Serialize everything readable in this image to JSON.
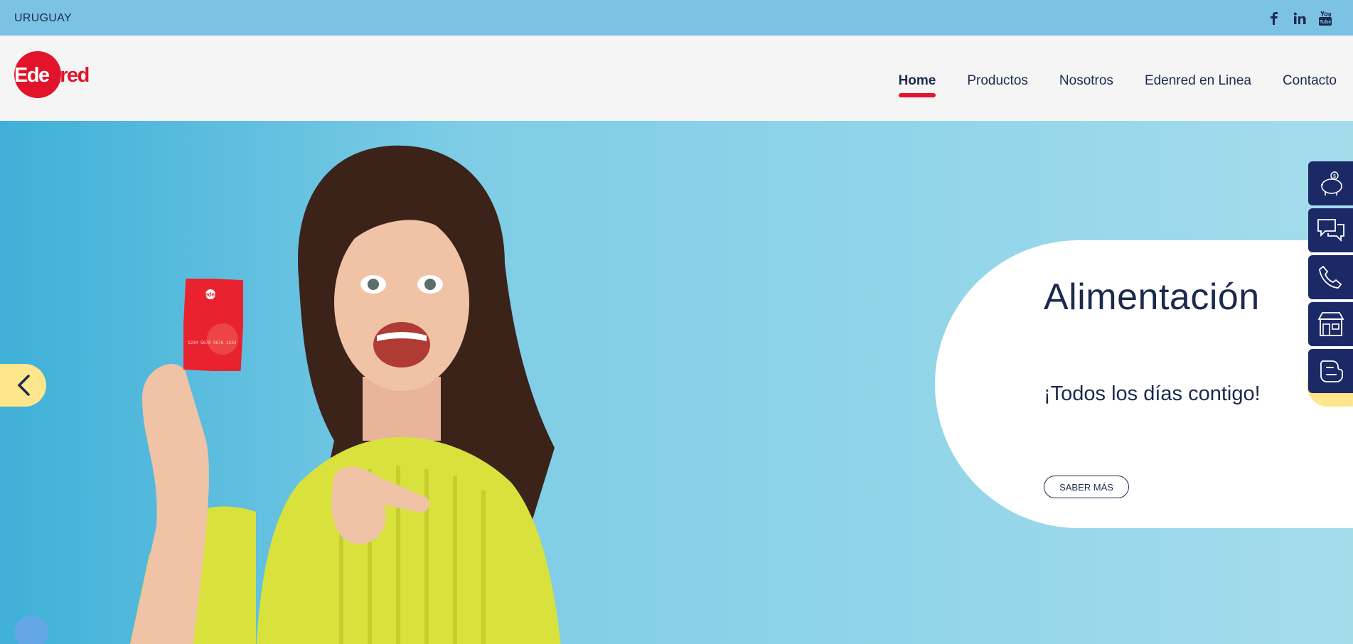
{
  "topbar": {
    "country": "URUGUAY",
    "social": [
      {
        "icon": "facebook-icon",
        "glyph": "f"
      },
      {
        "icon": "linkedin-icon",
        "glyph": "in"
      },
      {
        "icon": "youtube-icon",
        "glyph": "You"
      }
    ]
  },
  "header": {
    "logo_text": "Edenred",
    "nav": [
      {
        "label": "Home",
        "active": true
      },
      {
        "label": "Productos"
      },
      {
        "label": "Nosotros"
      },
      {
        "label": "Edenred en Linea"
      },
      {
        "label": "Contacto"
      }
    ]
  },
  "hero": {
    "title": "Alimentación",
    "subtitle": "¡Todos los días contigo!",
    "cta": "SABER MÁS",
    "card_brand": "edenred",
    "card_number": "1234 5678 9876 1234",
    "colors": {
      "brand_red": "#e1142c",
      "navy": "#1b2a4e",
      "accent_yellow": "#fde68c"
    }
  },
  "side_tabs": [
    {
      "icon": "piggy-bank-icon"
    },
    {
      "icon": "chat-icon"
    },
    {
      "icon": "phone-icon"
    },
    {
      "icon": "store-icon"
    },
    {
      "icon": "blogger-icon"
    }
  ]
}
